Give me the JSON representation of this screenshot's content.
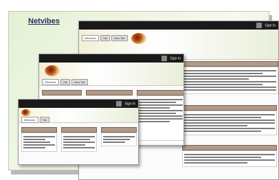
{
  "brand": "Netvibes",
  "top_links": {
    "sign_in": "Sign In"
  },
  "tabs": [
    "Welcome",
    "Tab",
    "New Tab"
  ],
  "colors": {
    "accent_brown": "#b09a86",
    "topbar": "#1a1a1a",
    "background_green": "#e4f0d4"
  }
}
